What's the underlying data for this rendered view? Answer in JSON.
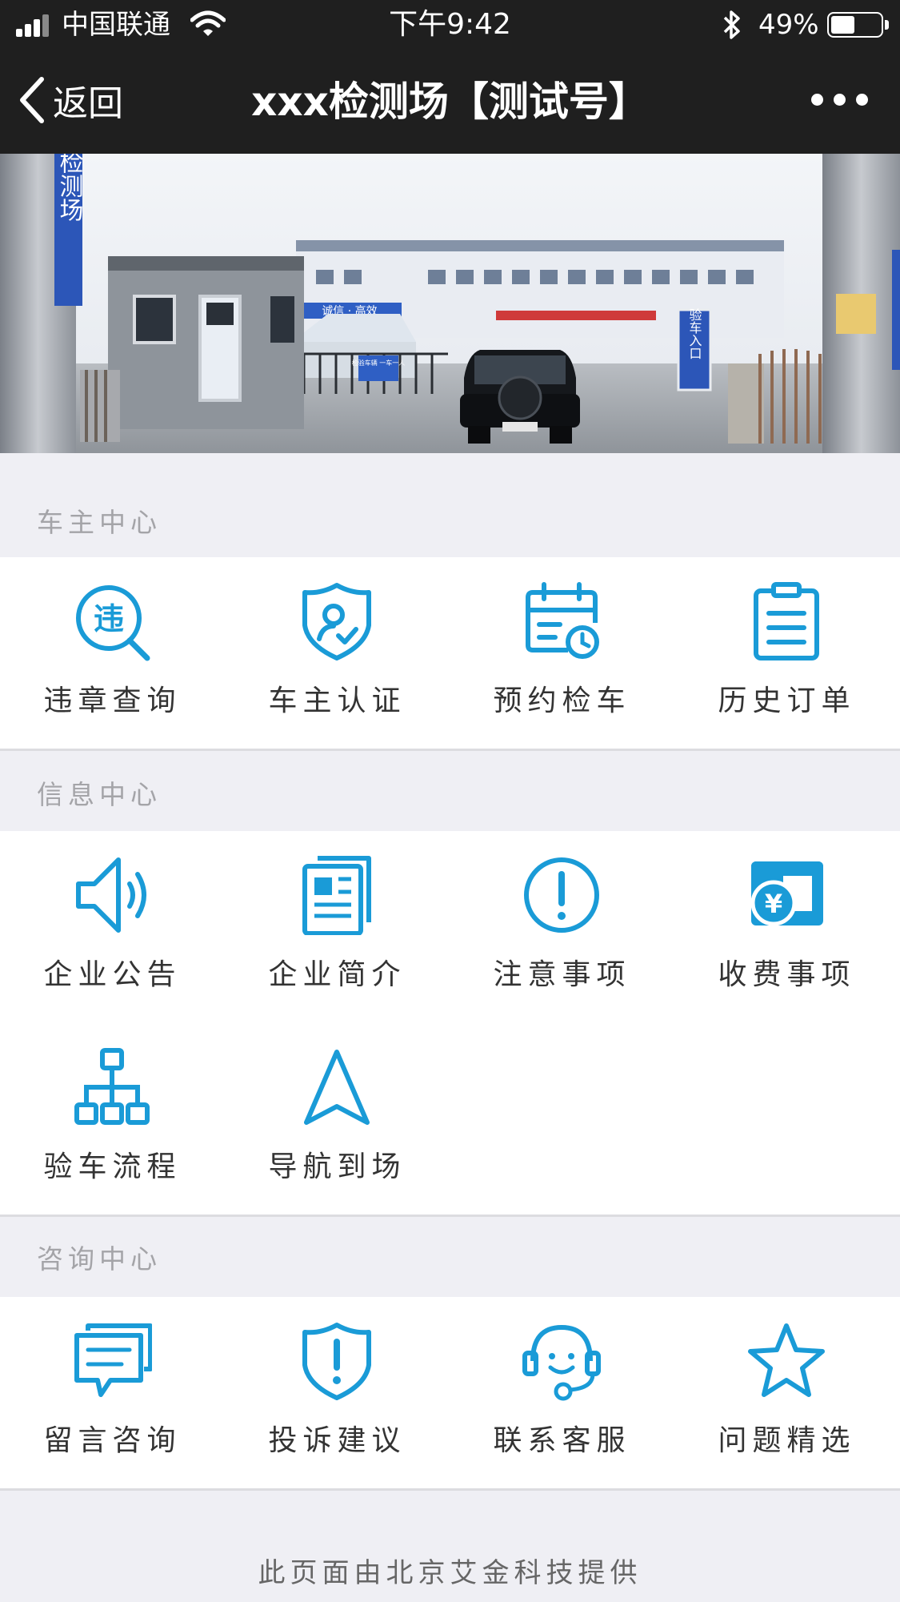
{
  "status_bar": {
    "carrier": "中国联通",
    "time": "下午9:42",
    "battery": "49%",
    "battery_level": 0.49
  },
  "nav": {
    "back_label": "返回",
    "title": "xxx检测场【测试号】"
  },
  "sections": [
    {
      "title": "车主中心",
      "items": [
        {
          "label": "违章查询",
          "icon": "violation-search-icon"
        },
        {
          "label": "车主认证",
          "icon": "owner-verify-shield-icon"
        },
        {
          "label": "预约检车",
          "icon": "calendar-clock-icon"
        },
        {
          "label": "历史订单",
          "icon": "clipboard-list-icon"
        }
      ]
    },
    {
      "title": "信息中心",
      "items": [
        {
          "label": "企业公告",
          "icon": "speaker-icon"
        },
        {
          "label": "企业简介",
          "icon": "document-icon"
        },
        {
          "label": "注意事项",
          "icon": "exclamation-circle-icon"
        },
        {
          "label": "收费事项",
          "icon": "yuan-card-icon"
        },
        {
          "label": "验车流程",
          "icon": "flowchart-icon"
        },
        {
          "label": "导航到场",
          "icon": "navigation-arrow-icon"
        }
      ]
    },
    {
      "title": "咨询中心",
      "items": [
        {
          "label": "留言咨询",
          "icon": "message-bubbles-icon"
        },
        {
          "label": "投诉建议",
          "icon": "shield-alert-icon"
        },
        {
          "label": "联系客服",
          "icon": "headset-support-icon"
        },
        {
          "label": "问题精选",
          "icon": "star-icon"
        }
      ]
    }
  ],
  "banner": {
    "signs": [
      "检测场",
      "验车入口",
      "检验车辆 一车一人",
      "诚信 · 高效"
    ]
  },
  "footer": "此页面由北京艾金科技提供",
  "colors": {
    "accent": "#1a9bd7",
    "nav_bg": "#1f1f1f",
    "page_bg": "#efeff4"
  }
}
